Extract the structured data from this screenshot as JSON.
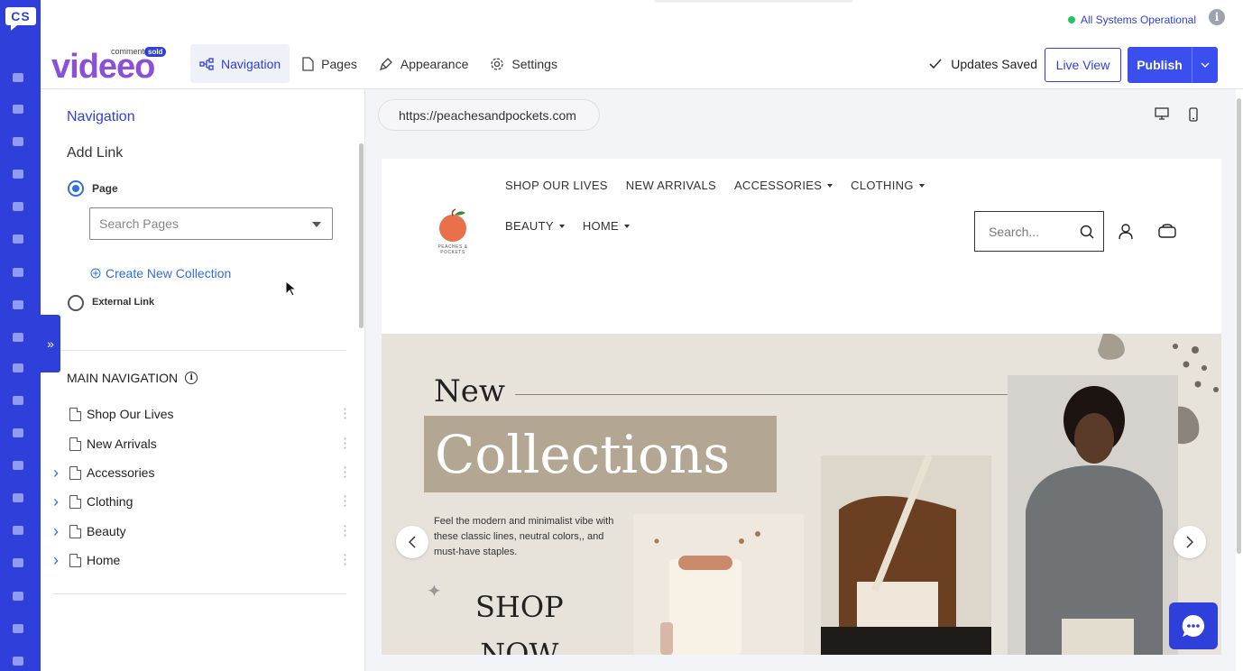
{
  "app": {
    "rail_logo": "CS",
    "brand_word": "videeo",
    "brand_super": "comment",
    "brand_badge": "sold",
    "status_text": "All Systems Operational",
    "accent_color": "#2f3fd9",
    "status_color": "#22c55e"
  },
  "rail": {
    "icons": [
      "dashboard-icon",
      "grid-icon",
      "feed-icon",
      "truck-icon",
      "truck-icon",
      "tag-icon",
      "user-icon",
      "feed-icon",
      "package-icon",
      "gear-icon",
      "facebook-icon",
      "chat-icon",
      "mobile-icon",
      "pie-chart-icon",
      "bar-chart-icon",
      "clock-icon",
      "cart-icon",
      "key-icon",
      "search-icon"
    ]
  },
  "toolbar": {
    "tabs": [
      {
        "label": "Navigation",
        "icon": "sitemap-icon"
      },
      {
        "label": "Pages",
        "icon": "page-icon"
      },
      {
        "label": "Appearance",
        "icon": "pen-icon"
      },
      {
        "label": "Settings",
        "icon": "gear-icon"
      }
    ],
    "saved_label": "Updates Saved",
    "live_view_label": "Live View",
    "publish_label": "Publish"
  },
  "sidebar": {
    "title": "Navigation",
    "add_link": "Add Link",
    "page_option": "Page",
    "search_placeholder": "Search Pages",
    "create_collection": "Create New Collection",
    "external_option": "External Link",
    "main_nav_title": "MAIN NAVIGATION",
    "items": [
      {
        "label": "Shop Our Lives",
        "expandable": false
      },
      {
        "label": "New Arrivals",
        "expandable": false
      },
      {
        "label": "Accessories",
        "expandable": true
      },
      {
        "label": "Clothing",
        "expandable": true
      },
      {
        "label": "Beauty",
        "expandable": true
      },
      {
        "label": "Home",
        "expandable": true
      }
    ]
  },
  "preview": {
    "url": "https://peachesandpockets.com",
    "site": {
      "nav_row1": [
        "SHOP OUR LIVES",
        "NEW ARRIVALS",
        "ACCESSORIES",
        "CLOTHING"
      ],
      "nav_row1_dd": [
        false,
        false,
        true,
        true
      ],
      "nav_row2": [
        "BEAUTY",
        "HOME"
      ],
      "search_placeholder": "Search...",
      "logo_text": "PEACHES & POCKETS",
      "hero": {
        "new": "New",
        "collections": "Collections",
        "tagline": "Feel the modern and minimalist vibe with these classic lines, neutral colors,, and must-have staples.",
        "shop": "SHOP",
        "now": "NOW"
      }
    }
  }
}
